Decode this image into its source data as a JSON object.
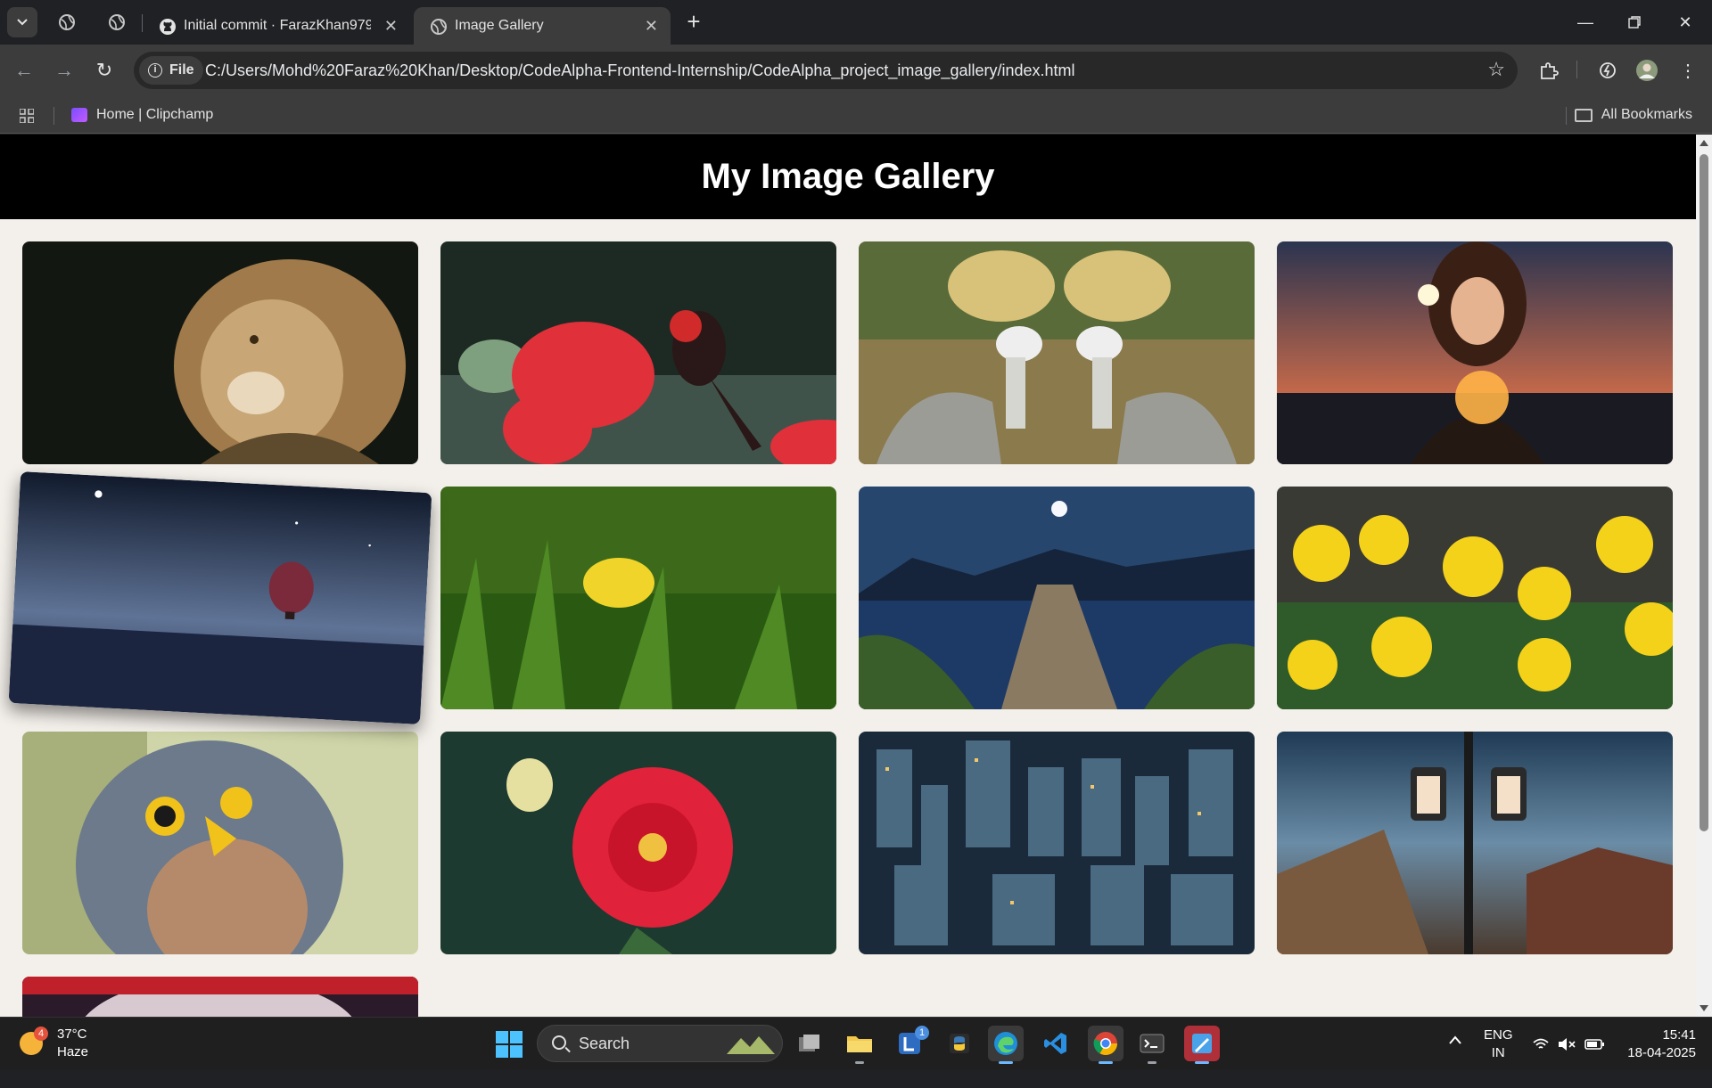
{
  "browser": {
    "tabs": [
      {
        "title": "Initial commit · FarazKhan9797",
        "icon": "github-icon",
        "active": false
      },
      {
        "title": "Image Gallery",
        "icon": "globe-icon",
        "active": true
      }
    ],
    "address": {
      "scheme_label": "File",
      "url": "C:/Users/Mohd%20Faraz%20Khan/Desktop/CodeAlpha-Frontend-Internship/CodeAlpha_project_image_gallery/index.html"
    },
    "bookmarks": {
      "items": [
        {
          "label": "Home | Clipchamp"
        }
      ],
      "all_label": "All Bookmarks"
    }
  },
  "page": {
    "title": "My Image Gallery",
    "images": [
      {
        "subject": "lion"
      },
      {
        "subject": "red bird on red flower"
      },
      {
        "subject": "two crowned cranes"
      },
      {
        "subject": "woman holding fairy lights"
      },
      {
        "subject": "hot air balloon over water at night",
        "state": "hovered"
      },
      {
        "subject": "yellow flower in grass"
      },
      {
        "subject": "lake pier under moon"
      },
      {
        "subject": "yellow marigolds"
      },
      {
        "subject": "kestrel bird"
      },
      {
        "subject": "red dahlia"
      },
      {
        "subject": "city aerial view"
      },
      {
        "subject": "street lamps at dusk"
      },
      {
        "subject": "colorful partial image"
      }
    ]
  },
  "taskbar": {
    "weather": {
      "badge": "4",
      "temp": "37°C",
      "condition": "Haze"
    },
    "search_label": "Search",
    "apps": [
      "task-view",
      "file-explorer",
      "linkedin",
      "python",
      "edge",
      "vscode",
      "chrome",
      "terminal",
      "paint"
    ],
    "linkedin_badge": "1",
    "language": {
      "line1": "ENG",
      "line2": "IN"
    },
    "clock": {
      "time": "15:41",
      "date": "18-04-2025"
    }
  }
}
